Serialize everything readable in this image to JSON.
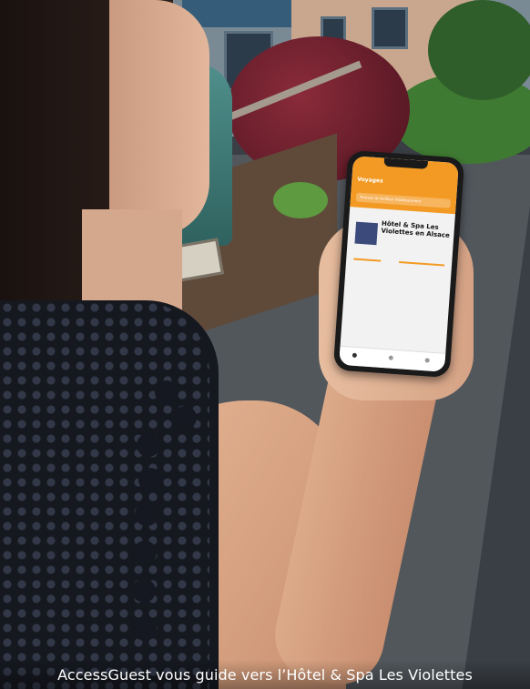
{
  "caption": "AccessGuest vous guide vers l’Hôtel & Spa Les Violettes",
  "phone_screen": {
    "app_title": "Voyages",
    "banner": "Trouvez le meilleur établissement",
    "card_title": "Hôtel & Spa Les Violettes en Alsace"
  },
  "colors": {
    "app_accent": "#f39a24",
    "caption_text": "#ffffff"
  }
}
